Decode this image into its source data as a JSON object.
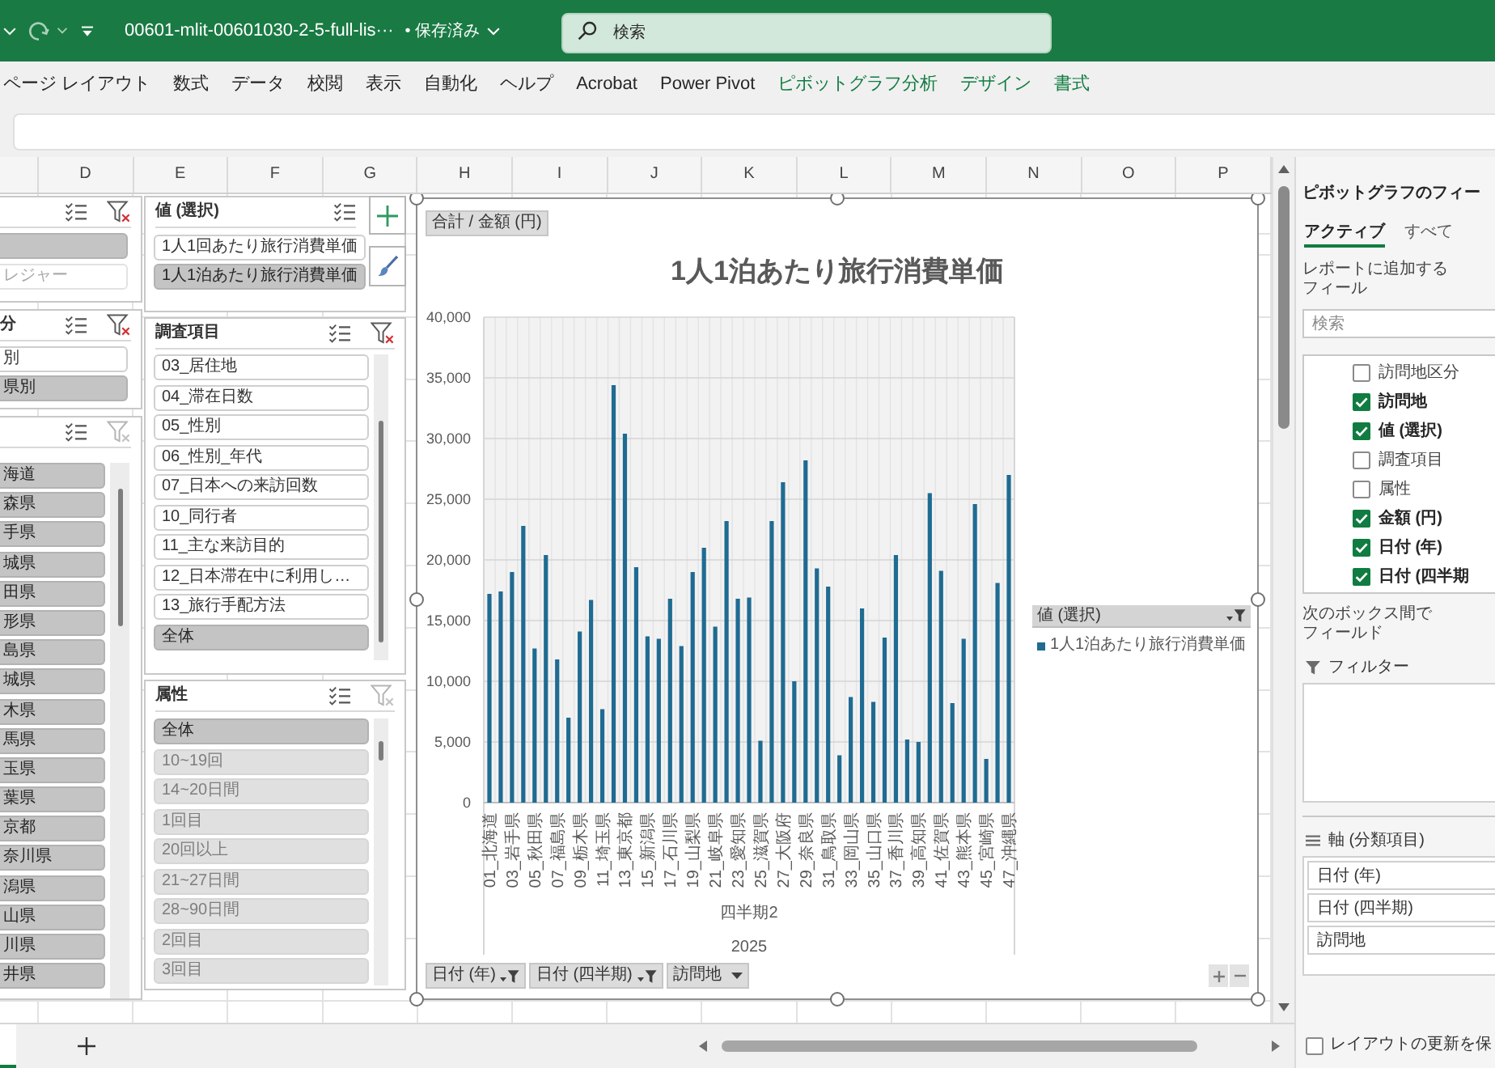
{
  "title_bar": {
    "file_name": "00601-mlit-00601030-2-5-full-lis···",
    "save_status": "• 保存済み",
    "search": {
      "placeholder": "検索"
    }
  },
  "ribbon_tabs": [
    {
      "label": "ページ レイアウト",
      "contextual": false
    },
    {
      "label": "数式",
      "contextual": false
    },
    {
      "label": "データ",
      "contextual": false
    },
    {
      "label": "校閲",
      "contextual": false
    },
    {
      "label": "表示",
      "contextual": false
    },
    {
      "label": "自動化",
      "contextual": false
    },
    {
      "label": "ヘルプ",
      "contextual": false
    },
    {
      "label": "Acrobat",
      "contextual": false
    },
    {
      "label": "Power Pivot",
      "contextual": false
    },
    {
      "label": "ピボットグラフ分析",
      "contextual": true
    },
    {
      "label": "デザイン",
      "contextual": true
    },
    {
      "label": "書式",
      "contextual": true
    }
  ],
  "columns": [
    "D",
    "E",
    "F",
    "G",
    "H",
    "I",
    "J",
    "K",
    "L",
    "M",
    "N",
    "O",
    "P"
  ],
  "slicers": [
    {
      "filtered": true,
      "items": [
        {
          "selected": true,
          "has_data": true
        },
        {
          "label": "レジャー",
          "selected": false,
          "has_data": false
        }
      ]
    },
    {
      "title": "分",
      "filtered": true,
      "items": [
        {
          "label": "別",
          "selected": false,
          "has_data": true
        },
        {
          "label": "県別",
          "selected": true,
          "has_data": true
        }
      ]
    },
    {
      "filtered": false,
      "items": [
        {
          "label": "海道",
          "selected": true,
          "has_data": true
        },
        {
          "label": "森県",
          "selected": true,
          "has_data": true
        },
        {
          "label": "手県",
          "selected": true,
          "has_data": true
        },
        {
          "label": "城県",
          "selected": true,
          "has_data": true
        },
        {
          "label": "田県",
          "selected": true,
          "has_data": true
        },
        {
          "label": "形県",
          "selected": true,
          "has_data": true
        },
        {
          "label": "島県",
          "selected": true,
          "has_data": true
        },
        {
          "label": "城県",
          "selected": true,
          "has_data": true
        },
        {
          "label": "木県",
          "selected": true,
          "has_data": true
        },
        {
          "label": "馬県",
          "selected": true,
          "has_data": true
        },
        {
          "label": "玉県",
          "selected": true,
          "has_data": true
        },
        {
          "label": "葉県",
          "selected": true,
          "has_data": true
        },
        {
          "label": "京都",
          "selected": true,
          "has_data": true
        },
        {
          "label": "奈川県",
          "selected": true,
          "has_data": true
        },
        {
          "label": "潟県",
          "selected": true,
          "has_data": true
        },
        {
          "label": "山県",
          "selected": true,
          "has_data": true
        },
        {
          "label": "川県",
          "selected": true,
          "has_data": true
        },
        {
          "label": "井県",
          "selected": true,
          "has_data": true
        }
      ]
    },
    {
      "title": "値 (選択)",
      "items": [
        {
          "label": "1人1回あたり旅行消費単価",
          "selected": false,
          "has_data": true
        },
        {
          "label": "1人1泊あたり旅行消費単価",
          "selected": true,
          "has_data": true
        }
      ]
    },
    {
      "title": "調査項目",
      "filtered": true,
      "items": [
        {
          "label": "03_居住地",
          "selected": false,
          "has_data": true
        },
        {
          "label": "04_滞在日数",
          "selected": false,
          "has_data": true
        },
        {
          "label": "05_性別",
          "selected": false,
          "has_data": true
        },
        {
          "label": "06_性別_年代",
          "selected": false,
          "has_data": true
        },
        {
          "label": "07_日本への来訪回数",
          "selected": false,
          "has_data": true
        },
        {
          "label": "10_同行者",
          "selected": false,
          "has_data": true
        },
        {
          "label": "11_主な来訪目的",
          "selected": false,
          "has_data": true
        },
        {
          "label": "12_日本滞在中に利用し…",
          "selected": false,
          "has_data": true
        },
        {
          "label": "13_旅行手配方法",
          "selected": false,
          "has_data": true
        },
        {
          "label": "全体",
          "selected": true,
          "has_data": true
        }
      ]
    },
    {
      "title": "属性",
      "filtered": false,
      "items": [
        {
          "label": "全体",
          "selected": true,
          "has_data": true
        },
        {
          "label": "10~19回",
          "selected": true,
          "has_data": false
        },
        {
          "label": "14~20日間",
          "selected": true,
          "has_data": false
        },
        {
          "label": "1回目",
          "selected": true,
          "has_data": false
        },
        {
          "label": "20回以上",
          "selected": true,
          "has_data": false
        },
        {
          "label": "21~27日間",
          "selected": true,
          "has_data": false
        },
        {
          "label": "28~90日間",
          "selected": true,
          "has_data": false
        },
        {
          "label": "2回目",
          "selected": true,
          "has_data": false
        },
        {
          "label": "3回目",
          "selected": true,
          "has_data": false
        }
      ]
    }
  ],
  "chart": {
    "value_field": "合計 / 金額 (円)",
    "chart_data": {
      "type": "bar",
      "title": "1人1泊あたり旅行消費単価",
      "categories": [
        "01_北海道",
        null,
        "03_岩手県",
        null,
        "05_秋田県",
        null,
        "07_福島県",
        null,
        "09_栃木県",
        null,
        "11_埼玉県",
        null,
        "13_東京都",
        null,
        "15_新潟県",
        null,
        "17_石川県",
        null,
        "19_山梨県",
        null,
        "21_岐阜県",
        null,
        "23_愛知県",
        null,
        "25_滋賀県",
        null,
        "27_大阪府",
        null,
        "29_奈良県",
        null,
        "31_鳥取県",
        null,
        "33_岡山県",
        null,
        "35_山口県",
        null,
        "37_香川県",
        null,
        "39_高知県",
        null,
        "41_佐賀県",
        null,
        "43_熊本県",
        null,
        "45_宮崎県",
        null,
        "47_沖縄県"
      ],
      "series": [
        {
          "name": "1人1泊あたり旅行消費単価",
          "color": "#1f6b92",
          "values": [
            17200,
            17400,
            19000,
            22800,
            12700,
            20400,
            11800,
            7000,
            14100,
            16700,
            7700,
            34400,
            30400,
            19400,
            13700,
            13500,
            16800,
            12900,
            19000,
            21000,
            14500,
            23200,
            16800,
            16900,
            5100,
            23200,
            26400,
            10000,
            28200,
            19300,
            17800,
            3900,
            8700,
            16000,
            8300,
            13600,
            20400,
            5200,
            5000,
            25500,
            19100,
            8200,
            13500,
            24600,
            3600,
            18100,
            27000
          ]
        }
      ],
      "ylim": [
        0,
        40000
      ],
      "yticks": [
        {
          "value": 0,
          "label": "0"
        },
        {
          "value": 5000,
          "label": "5,000"
        },
        {
          "value": 10000,
          "label": "10,000"
        },
        {
          "value": 15000,
          "label": "15,000"
        },
        {
          "value": 20000,
          "label": "20,000"
        },
        {
          "value": 25000,
          "label": "25,000"
        },
        {
          "value": 30000,
          "label": "30,000"
        },
        {
          "value": 35000,
          "label": "35,000"
        },
        {
          "value": 40000,
          "label": "40,000"
        }
      ],
      "grid": true
    },
    "axis_group_labels": [
      "四半期2",
      "2025"
    ],
    "legend": {
      "field": "値 (選択)",
      "filtered": true
    },
    "axis_field_buttons": [
      {
        "label": "日付 (年)",
        "filtered": true
      },
      {
        "label": "日付 (四半期)",
        "filtered": true
      },
      {
        "label": "訪問地",
        "filtered": false
      }
    ]
  },
  "field_panel": {
    "title": "ピボットグラフのフィー",
    "tabs": [
      {
        "label": "アクティブ",
        "selected": true
      },
      {
        "label": "すべて",
        "selected": false
      }
    ],
    "instruction": "レポートに追加するフィール",
    "search": {
      "placeholder": "検索"
    },
    "fields": [
      {
        "label": "訪問地区分",
        "checked": false
      },
      {
        "label": "訪問地",
        "checked": true
      },
      {
        "label": "値 (選択)",
        "checked": true
      },
      {
        "label": "調査項目",
        "checked": false
      },
      {
        "label": "属性",
        "checked": false
      },
      {
        "label": "金額 (円)",
        "checked": true
      },
      {
        "label": "日付 (年)",
        "checked": true
      },
      {
        "label": "日付 (四半期",
        "checked": true
      }
    ],
    "areas_hint": "次のボックス間でフィールド",
    "filter_area": {
      "title": "フィルター"
    },
    "axis_area": {
      "title": "軸 (分類項目)",
      "items": [
        "日付 (年)",
        "日付 (四半期)",
        "訪問地"
      ]
    },
    "defer_update": {
      "label": "レイアウトの更新を保",
      "checked": false
    }
  }
}
